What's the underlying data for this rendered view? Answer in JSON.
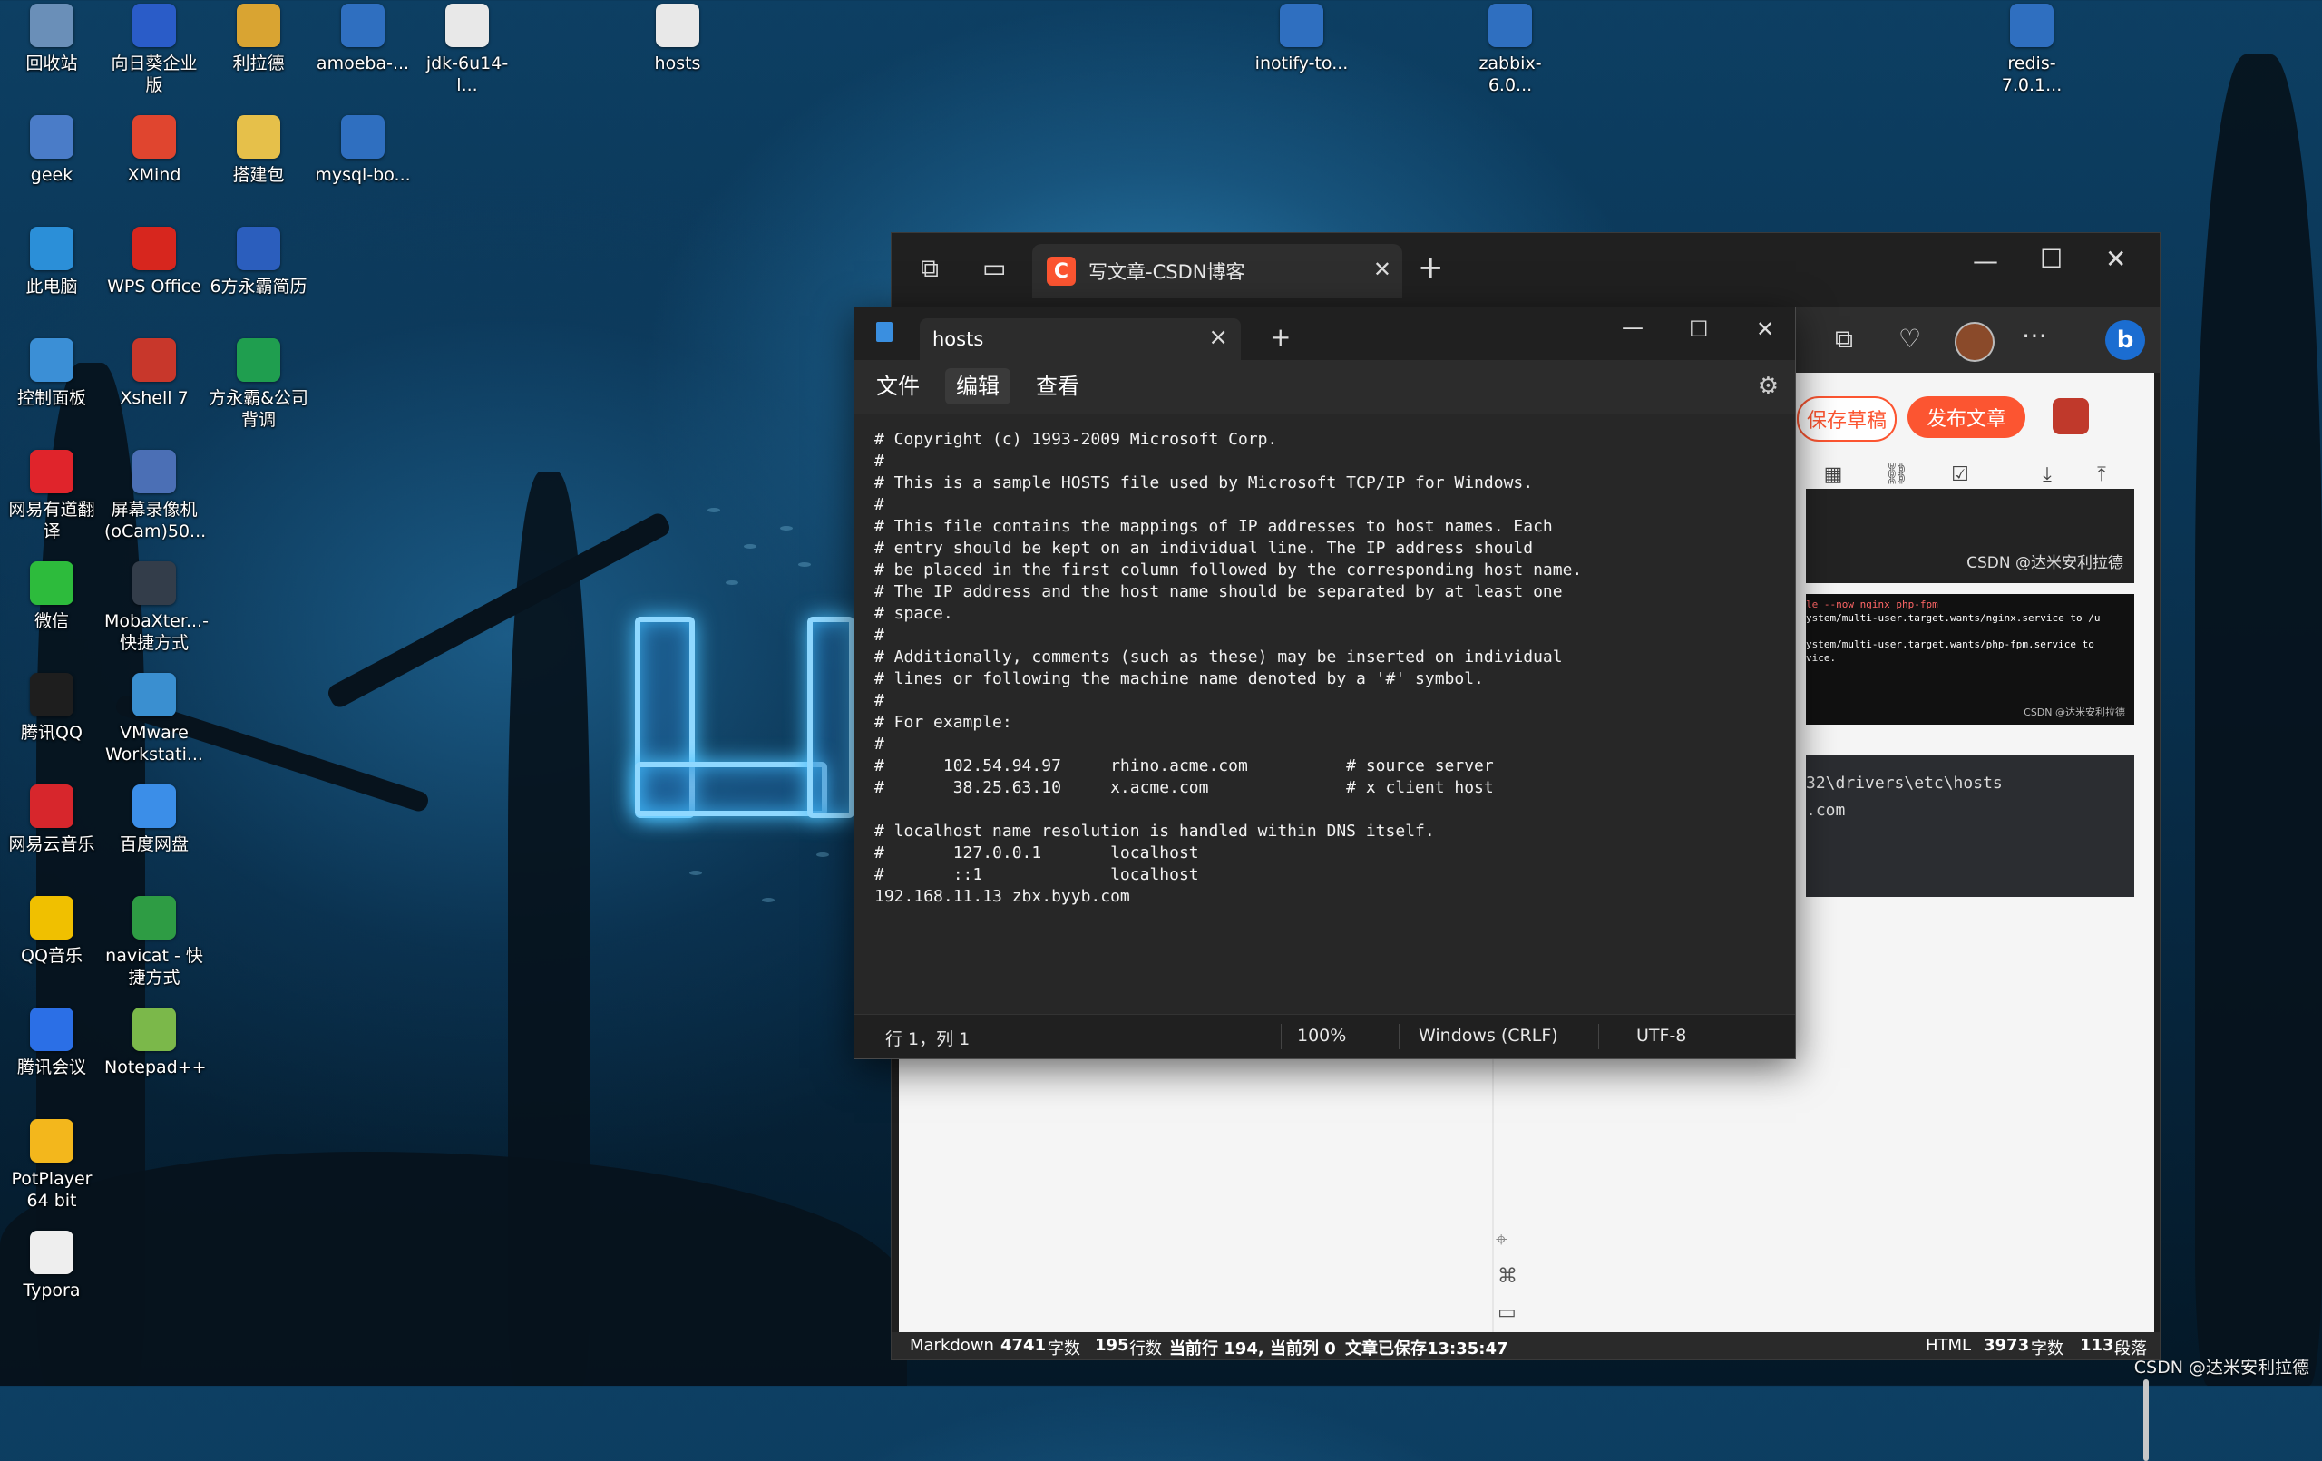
{
  "desktop": {
    "icons": [
      {
        "label": "回收站",
        "icon": "recycle-bin-icon",
        "color": "#6a8fb8"
      },
      {
        "label": "向日葵企业版",
        "icon": "sunflower-remote-icon",
        "color": "#2a5cc8"
      },
      {
        "label": "利拉德",
        "icon": "folder-icon",
        "color": "#d9a432"
      },
      {
        "label": "amoeba-...",
        "icon": "document-icon",
        "color": "#2f6fc0"
      },
      {
        "label": "jdk-6u14-l...",
        "icon": "file-icon",
        "color": "#e8e8e8"
      },
      {
        "label": "hosts",
        "icon": "file-icon",
        "color": "#e8e8e8"
      },
      {
        "label": "inotify-to...",
        "icon": "document-icon",
        "color": "#2f6fc0"
      },
      {
        "label": "zabbix-6.0...",
        "icon": "document-icon",
        "color": "#2f6fc0"
      },
      {
        "label": "redis-7.0.1...",
        "icon": "document-icon",
        "color": "#2f6fc0"
      },
      {
        "label": "geek",
        "icon": "geek-uninstaller-icon",
        "color": "#4a7cc8"
      },
      {
        "label": "XMind",
        "icon": "xmind-icon",
        "color": "#e0452f"
      },
      {
        "label": "搭建包",
        "icon": "folder-icon",
        "color": "#e6c04a"
      },
      {
        "label": "mysql-bo...",
        "icon": "document-icon",
        "color": "#2f6fc0"
      },
      {
        "label": "此电脑",
        "icon": "computer-icon",
        "color": "#2b8fd8"
      },
      {
        "label": "WPS Office",
        "icon": "wps-icon",
        "color": "#d7261e"
      },
      {
        "label": "6方永霸简历",
        "icon": "word-document-icon",
        "color": "#2b5ebd"
      },
      {
        "label": "控制面板",
        "icon": "control-panel-icon",
        "color": "#3b8fd6"
      },
      {
        "label": "Xshell 7",
        "icon": "xshell-icon",
        "color": "#c8372b"
      },
      {
        "label": "方永霸&公司背调",
        "icon": "spreadsheet-icon",
        "color": "#1f9e4f"
      },
      {
        "label": "网易有道翻译",
        "icon": "youdao-icon",
        "color": "#e0242b"
      },
      {
        "label": "屏幕录像机(oCam)50...",
        "icon": "ocam-icon",
        "color": "#4b6fb5"
      },
      {
        "label": "微信",
        "icon": "wechat-icon",
        "color": "#2dbb3c"
      },
      {
        "label": "MobaXter...- 快捷方式",
        "icon": "mobaxterm-icon",
        "color": "#333d4a"
      },
      {
        "label": "腾讯QQ",
        "icon": "qq-icon",
        "color": "#1e1e1e"
      },
      {
        "label": "VMware Workstati...",
        "icon": "vmware-icon",
        "color": "#3a8fd0"
      },
      {
        "label": "网易云音乐",
        "icon": "netease-music-icon",
        "color": "#d7262c"
      },
      {
        "label": "百度网盘",
        "icon": "baidu-netdisk-icon",
        "color": "#3b8ee8"
      },
      {
        "label": "QQ音乐",
        "icon": "qq-music-icon",
        "color": "#f0c000"
      },
      {
        "label": "navicat - 快捷方式",
        "icon": "navicat-icon",
        "color": "#2e9c44"
      },
      {
        "label": "腾讯会议",
        "icon": "tencent-meeting-icon",
        "color": "#2b6fe6"
      },
      {
        "label": "Notepad++",
        "icon": "notepadpp-icon",
        "color": "#7bb84a"
      },
      {
        "label": "PotPlayer 64 bit",
        "icon": "potplayer-icon",
        "color": "#f3b71c"
      },
      {
        "label": "Typora",
        "icon": "typora-icon",
        "color": "#eeeeee"
      }
    ]
  },
  "browser": {
    "tab_title": "写文章-CSDN博客",
    "tab_favicon": "C",
    "save_draft": "保存草稿",
    "publish": "发布文章",
    "tools": [
      "表格",
      "超链接",
      "投票",
      "导入",
      "导出"
    ],
    "watermark1": "CSDN @达米安利拉德",
    "watermark2": "CSDN @达米安利拉德",
    "code_snippet": {
      "line1": "le --now nginx php-fpm",
      "line2": "ystem/multi-user.target.wants/nginx.service to /u",
      "line3": "ystem/multi-user.target.wants/php-fpm.service to",
      "line4": "vice."
    },
    "code_block": {
      "line1": "32\\drivers\\etc\\hosts",
      "line2": ".com"
    },
    "status": {
      "mode": "Markdown",
      "md_chars": "4741",
      "chars_unit": "字数",
      "md_lines": "195",
      "lines_unit": "行数",
      "cur_pos": "当前行 194, 当前列 0",
      "saved": "文章已保存13:35:47",
      "html_mode": "HTML",
      "html_chars": "3973",
      "html_paras": "113",
      "paras_unit": "段落"
    }
  },
  "notepad": {
    "tab_title": "hosts",
    "menu": {
      "file": "文件",
      "edit": "编辑",
      "view": "查看"
    },
    "content": "# Copyright (c) 1993-2009 Microsoft Corp.\n#\n# This is a sample HOSTS file used by Microsoft TCP/IP for Windows.\n#\n# This file contains the mappings of IP addresses to host names. Each\n# entry should be kept on an individual line. The IP address should\n# be placed in the first column followed by the corresponding host name.\n# The IP address and the host name should be separated by at least one\n# space.\n#\n# Additionally, comments (such as these) may be inserted on individual\n# lines or following the machine name denoted by a '#' symbol.\n#\n# For example:\n#\n#      102.54.94.97     rhino.acme.com          # source server\n#       38.25.63.10     x.acme.com              # x client host\n\n# localhost name resolution is handled within DNS itself.\n#\t127.0.0.1       localhost\n#\t::1             localhost\n192.168.11.13 zbx.byyb.com",
    "status": {
      "position": "行 1，列 1",
      "zoom": "100%",
      "line_ending": "Windows (CRLF)",
      "encoding": "UTF-8"
    }
  },
  "corner_watermark": "CSDN @达米安利拉德"
}
